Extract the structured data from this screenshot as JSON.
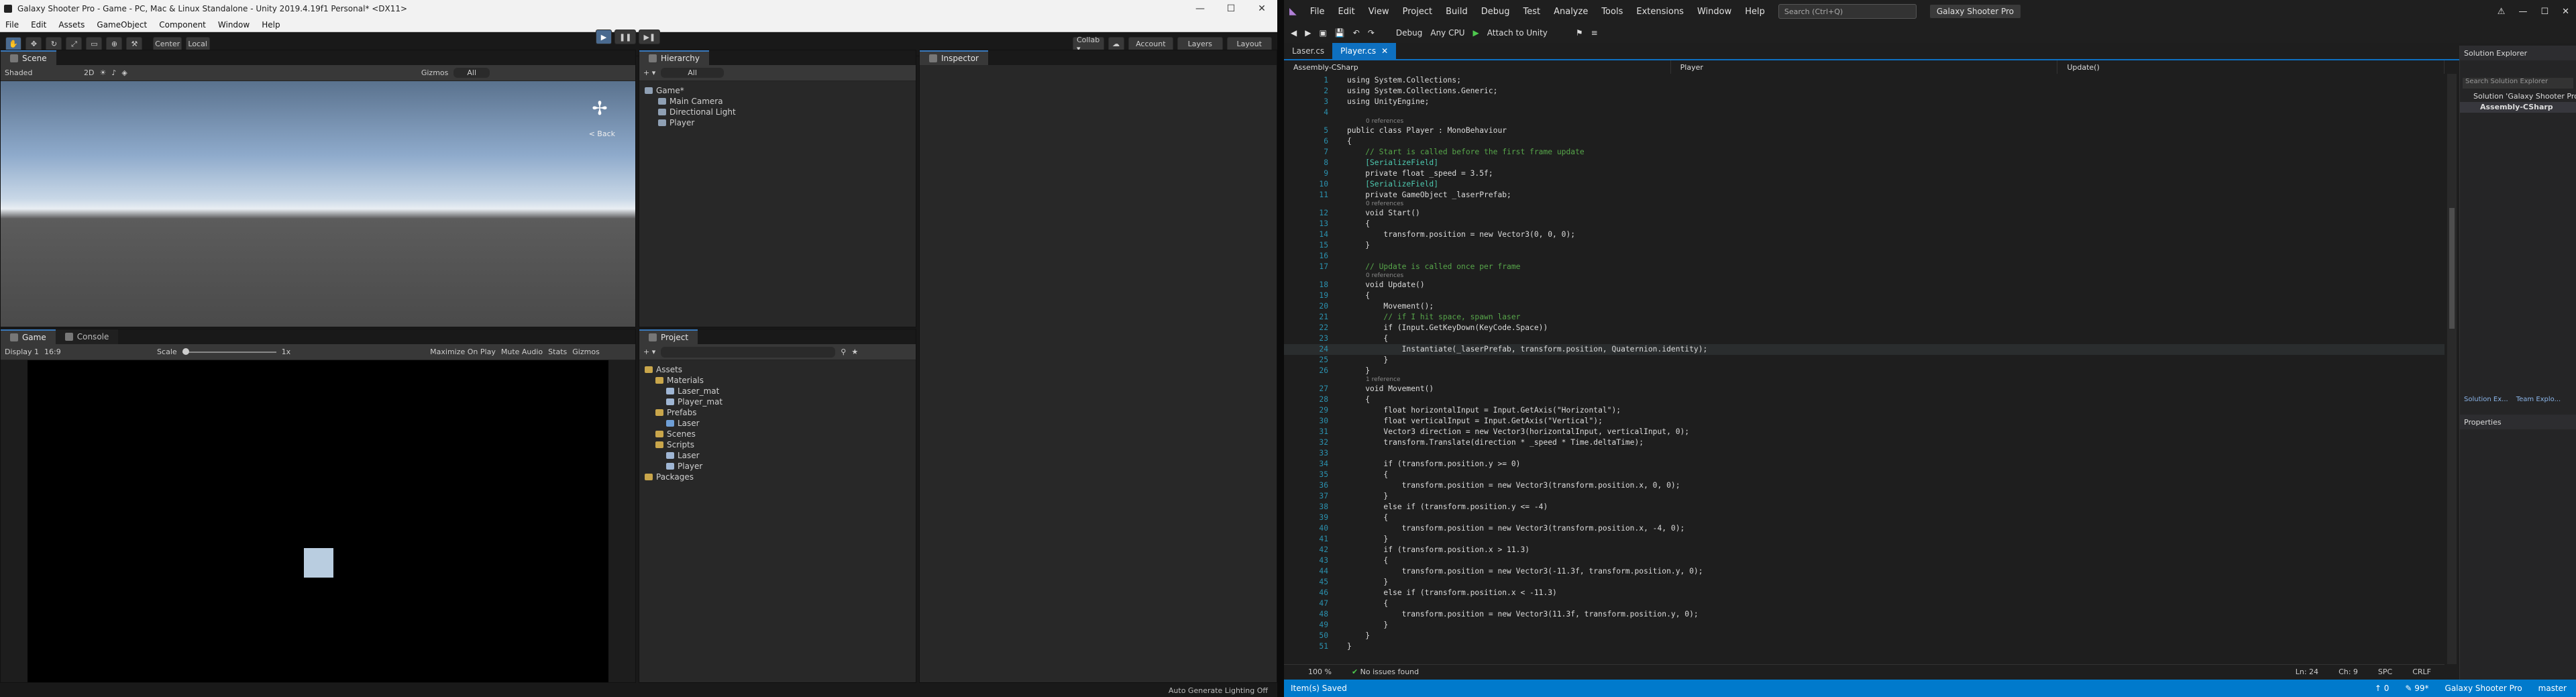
{
  "unity": {
    "title": "Galaxy Shooter Pro - Game - PC, Mac & Linux Standalone - Unity 2019.4.19f1 Personal* <DX11>",
    "window_controls": [
      "—",
      "☐",
      "✕"
    ],
    "menu": [
      "File",
      "Edit",
      "Assets",
      "GameObject",
      "Component",
      "Window",
      "Help"
    ],
    "toolbar": {
      "pivot": "Center",
      "space": "Local",
      "collab": "Collab ▾",
      "account": "Account",
      "layers": "Layers",
      "layout": "Layout"
    },
    "scene": {
      "tab": "Scene",
      "shading": "Shaded",
      "mode_2d": "2D",
      "gizmos": "Gizmos",
      "search": "All",
      "gizmo_label": "< Back"
    },
    "game": {
      "tabs": [
        "Game",
        "Console"
      ],
      "display": "Display 1",
      "aspect": "16:9",
      "scale_label": "Scale",
      "scale_value": "1x",
      "options": [
        "Maximize On Play",
        "Mute Audio",
        "Stats",
        "Gizmos"
      ]
    },
    "hierarchy": {
      "tab": "Hierarchy",
      "search": "All",
      "scene_name": "Game*",
      "items": [
        "Main Camera",
        "Directional Light",
        "Player"
      ]
    },
    "inspector": {
      "tab": "Inspector"
    },
    "project": {
      "tab": "Project",
      "tree": [
        {
          "label": "Assets",
          "level": 0,
          "icon": "folder"
        },
        {
          "label": "Materials",
          "level": 1,
          "icon": "folder"
        },
        {
          "label": "Laser_mat",
          "level": 2,
          "icon": "file"
        },
        {
          "label": "Player_mat",
          "level": 2,
          "icon": "file"
        },
        {
          "label": "Prefabs",
          "level": 1,
          "icon": "folder"
        },
        {
          "label": "Laser",
          "level": 2,
          "icon": "cube"
        },
        {
          "label": "Scenes",
          "level": 1,
          "icon": "folder"
        },
        {
          "label": "Scripts",
          "level": 1,
          "icon": "folder"
        },
        {
          "label": "Laser",
          "level": 2,
          "icon": "file"
        },
        {
          "label": "Player",
          "level": 2,
          "icon": "file"
        },
        {
          "label": "Packages",
          "level": 0,
          "icon": "folder"
        }
      ]
    },
    "status": "Auto Generate Lighting Off"
  },
  "vs": {
    "menu": [
      "File",
      "Edit",
      "View",
      "Project",
      "Build",
      "Debug",
      "Test",
      "Analyze",
      "Tools",
      "Extensions",
      "Window",
      "Help"
    ],
    "search_placeholder": "Search (Ctrl+Q)",
    "project_name": "Galaxy Shooter Pro",
    "toolbar": {
      "config": "Debug",
      "platform": "Any CPU",
      "attach": "Attach to Unity"
    },
    "tabs": [
      "Laser.cs",
      "Player.cs"
    ],
    "active_tab": "Player.cs",
    "nav": [
      "Assembly-CSharp",
      "Player",
      "Update()"
    ],
    "zoom": "100 %",
    "issues": "No issues found",
    "position": {
      "ln": "Ln: 24",
      "ch": "Ch: 9",
      "spc": "SPC",
      "crlf": "CRLF"
    },
    "status_left": "Item(s) Saved",
    "status_right": [
      "↑ 0",
      "✎ 99*",
      "Galaxy Shooter Pro",
      "master"
    ],
    "solution_explorer": {
      "title": "Solution Explorer",
      "search": "Search Solution Explorer",
      "items": [
        "Solution 'Galaxy Shooter Pro'",
        "Assembly-CSharp"
      ],
      "tabs": [
        "Solution Ex...",
        "Team Explo..."
      ]
    },
    "properties": {
      "title": "Properties"
    },
    "code": [
      {
        "n": "1",
        "t": "using System.Collections;"
      },
      {
        "n": "2",
        "t": "using System.Collections.Generic;"
      },
      {
        "n": "3",
        "t": "using UnityEngine;"
      },
      {
        "n": "4",
        "t": ""
      },
      {
        "hint": "0 references"
      },
      {
        "n": "5",
        "t": "public class Player : MonoBehaviour"
      },
      {
        "n": "6",
        "t": "{"
      },
      {
        "n": "7",
        "t": "    // Start is called before the first frame update"
      },
      {
        "n": "8",
        "t": "    [SerializeField]"
      },
      {
        "n": "9",
        "t": "    private float _speed = 3.5f;"
      },
      {
        "n": "10",
        "t": "    [SerializeField]"
      },
      {
        "n": "11",
        "t": "    private GameObject _laserPrefab;"
      },
      {
        "hint": "0 references"
      },
      {
        "n": "12",
        "t": "    void Start()"
      },
      {
        "n": "13",
        "t": "    {"
      },
      {
        "n": "14",
        "t": "        transform.position = new Vector3(0, 0, 0);"
      },
      {
        "n": "15",
        "t": "    }"
      },
      {
        "n": "16",
        "t": ""
      },
      {
        "n": "17",
        "t": "    // Update is called once per frame"
      },
      {
        "hint": "0 references"
      },
      {
        "n": "18",
        "t": "    void Update()"
      },
      {
        "n": "19",
        "t": "    {"
      },
      {
        "n": "20",
        "t": "        Movement();"
      },
      {
        "n": "21",
        "t": "        // if I hit space, spawn laser"
      },
      {
        "n": "22",
        "t": "        if (Input.GetKeyDown(KeyCode.Space))"
      },
      {
        "n": "23",
        "t": "        {"
      },
      {
        "n": "24",
        "t": "            Instantiate(_laserPrefab, transform.position, Quaternion.identity);",
        "current": true
      },
      {
        "n": "25",
        "t": "        }"
      },
      {
        "n": "26",
        "t": "    }"
      },
      {
        "hint": "1 reference"
      },
      {
        "n": "27",
        "t": "    void Movement()"
      },
      {
        "n": "28",
        "t": "    {"
      },
      {
        "n": "29",
        "t": "        float horizontalInput = Input.GetAxis(\"Horizontal\");"
      },
      {
        "n": "30",
        "t": "        float verticalInput = Input.GetAxis(\"Vertical\");"
      },
      {
        "n": "31",
        "t": "        Vector3 direction = new Vector3(horizontalInput, verticalInput, 0);"
      },
      {
        "n": "32",
        "t": "        transform.Translate(direction * _speed * Time.deltaTime);"
      },
      {
        "n": "33",
        "t": ""
      },
      {
        "n": "34",
        "t": "        if (transform.position.y >= 0)"
      },
      {
        "n": "35",
        "t": "        {"
      },
      {
        "n": "36",
        "t": "            transform.position = new Vector3(transform.position.x, 0, 0);"
      },
      {
        "n": "37",
        "t": "        }"
      },
      {
        "n": "38",
        "t": "        else if (transform.position.y <= -4)"
      },
      {
        "n": "39",
        "t": "        {"
      },
      {
        "n": "40",
        "t": "            transform.position = new Vector3(transform.position.x, -4, 0);"
      },
      {
        "n": "41",
        "t": "        }"
      },
      {
        "n": "42",
        "t": "        if (transform.position.x > 11.3)"
      },
      {
        "n": "43",
        "t": "        {"
      },
      {
        "n": "44",
        "t": "            transform.position = new Vector3(-11.3f, transform.position.y, 0);"
      },
      {
        "n": "45",
        "t": "        }"
      },
      {
        "n": "46",
        "t": "        else if (transform.position.x < -11.3)"
      },
      {
        "n": "47",
        "t": "        {"
      },
      {
        "n": "48",
        "t": "            transform.position = new Vector3(11.3f, transform.position.y, 0);"
      },
      {
        "n": "49",
        "t": "        }"
      },
      {
        "n": "50",
        "t": "    }"
      },
      {
        "n": "51",
        "t": "}"
      }
    ]
  }
}
